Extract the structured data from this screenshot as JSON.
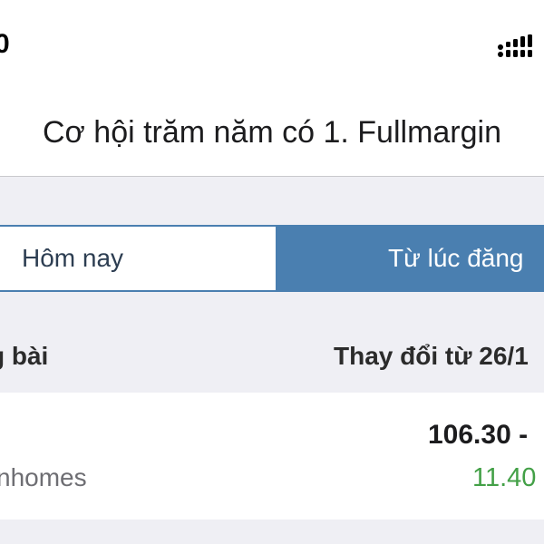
{
  "status_bar": {
    "time": "0",
    "signal_icon": "signal-bars-icon"
  },
  "header": {
    "title": "Cơ hội trăm năm có 1. Fullmargin"
  },
  "segments": {
    "today": "Hôm nay",
    "since_posted": "Từ lúc đăng"
  },
  "columns": {
    "left": "g bài",
    "right": "Thay đổi từ 26/1"
  },
  "rows": [
    {
      "name": "nhomes",
      "price": "106.30 -",
      "change": "11.40"
    }
  ],
  "colors": {
    "accent": "#4a7fb0",
    "positive": "#43a047",
    "background": "#efeff4"
  }
}
